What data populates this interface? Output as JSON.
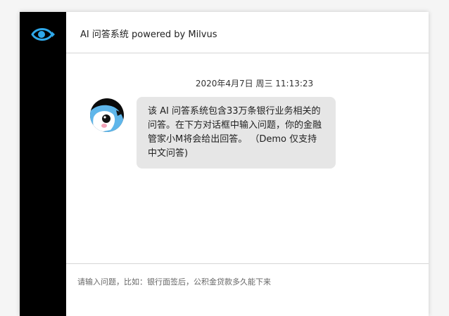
{
  "app": {
    "title": "AI 问答系统 powered by Milvus",
    "logo_icon": "eye-icon",
    "accent_color": "#2fa8e9"
  },
  "chat": {
    "timestamp": "2020年4月7日 周三 11:13:23",
    "messages": [
      {
        "sender_avatar_icon": "penguin-bot-avatar",
        "text": "该 AI 问答系统包含33万条银行业务相关的问答。在下方对话框中输入问题，你的金融管家小M将会给出回答。 （Demo 仅支持中文问答)"
      }
    ]
  },
  "input": {
    "placeholder": "请输入问题，比如：银行面签后，公积金贷款多久能下来",
    "value": ""
  }
}
